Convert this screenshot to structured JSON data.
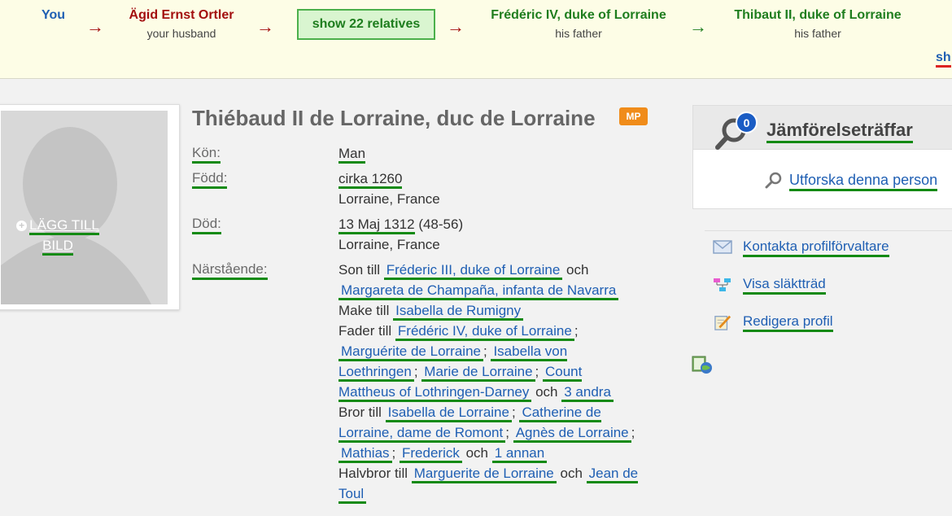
{
  "path": {
    "you_label": "You",
    "husband": {
      "name": "Ägid Ernst Ortler",
      "relation": "your husband"
    },
    "relatives_button": "show 22 relatives",
    "father1": {
      "name": "Frédéric IV, duke of Lorraine",
      "relation": "his father"
    },
    "father2": {
      "name": "Thibaut II, duke of Lorraine",
      "relation": "his father"
    },
    "more_link": "sh",
    "arrow_glyph": "→"
  },
  "photo": {
    "add_label_line1": "LÄGG TILL",
    "add_label_line2": "BILD",
    "plus_glyph": "+"
  },
  "profile": {
    "title": "Thiébaud II de Lorraine, duc de Lorraine",
    "badge": "MP",
    "gender_label": "Kön:",
    "gender": "Man",
    "born_label": "Född:",
    "born_date": "cirka 1260",
    "born_place": "Lorraine, France",
    "died_label": "Död:",
    "died_date": "13 Maj 1312",
    "died_age": "(48-56)",
    "died_place": "Lorraine, France",
    "relatives_label": "Närstående:"
  },
  "relatives": {
    "son_of": "Son till",
    "parent1": "Fréderic III, duke of Lorraine",
    "and": "och",
    "parent2": "Margareta de Champaña, infanta de Navarra",
    "husband_of": "Make till",
    "spouse": "Isabella de Rumigny",
    "father_of": "Fader till",
    "children": [
      "Frédéric IV, duke of Lorraine",
      "Marguérite de Lorraine",
      "Isabella von Loethringen",
      "Marie de Lorraine",
      "Count Mattheus of Lothringen-Darney"
    ],
    "children_more": "3 andra",
    "brother_of": "Bror till",
    "siblings": [
      "Isabella de Lorraine",
      "Catherine de Lorraine, dame de Romont",
      "Agnès de Lorraine",
      "Mathias",
      "Frederick"
    ],
    "siblings_more": "1 annan",
    "half_brother_of": "Halvbror till",
    "half_siblings": [
      "Marguerite de Lorraine",
      "Jean de Toul"
    ],
    "separator": ";"
  },
  "sidebar": {
    "match_title": "Jämförelseträffar",
    "match_count": "0",
    "explore": "Utforska denna person",
    "contact": "Kontakta profilförvaltare",
    "tree": "Visa släktträd",
    "edit": "Redigera profil"
  },
  "colors": {
    "link": "#1f5fb3",
    "underline": "#148a14",
    "badge": "#f08c1a",
    "path_red": "#a30f0f",
    "path_green": "#1e7d1e"
  }
}
